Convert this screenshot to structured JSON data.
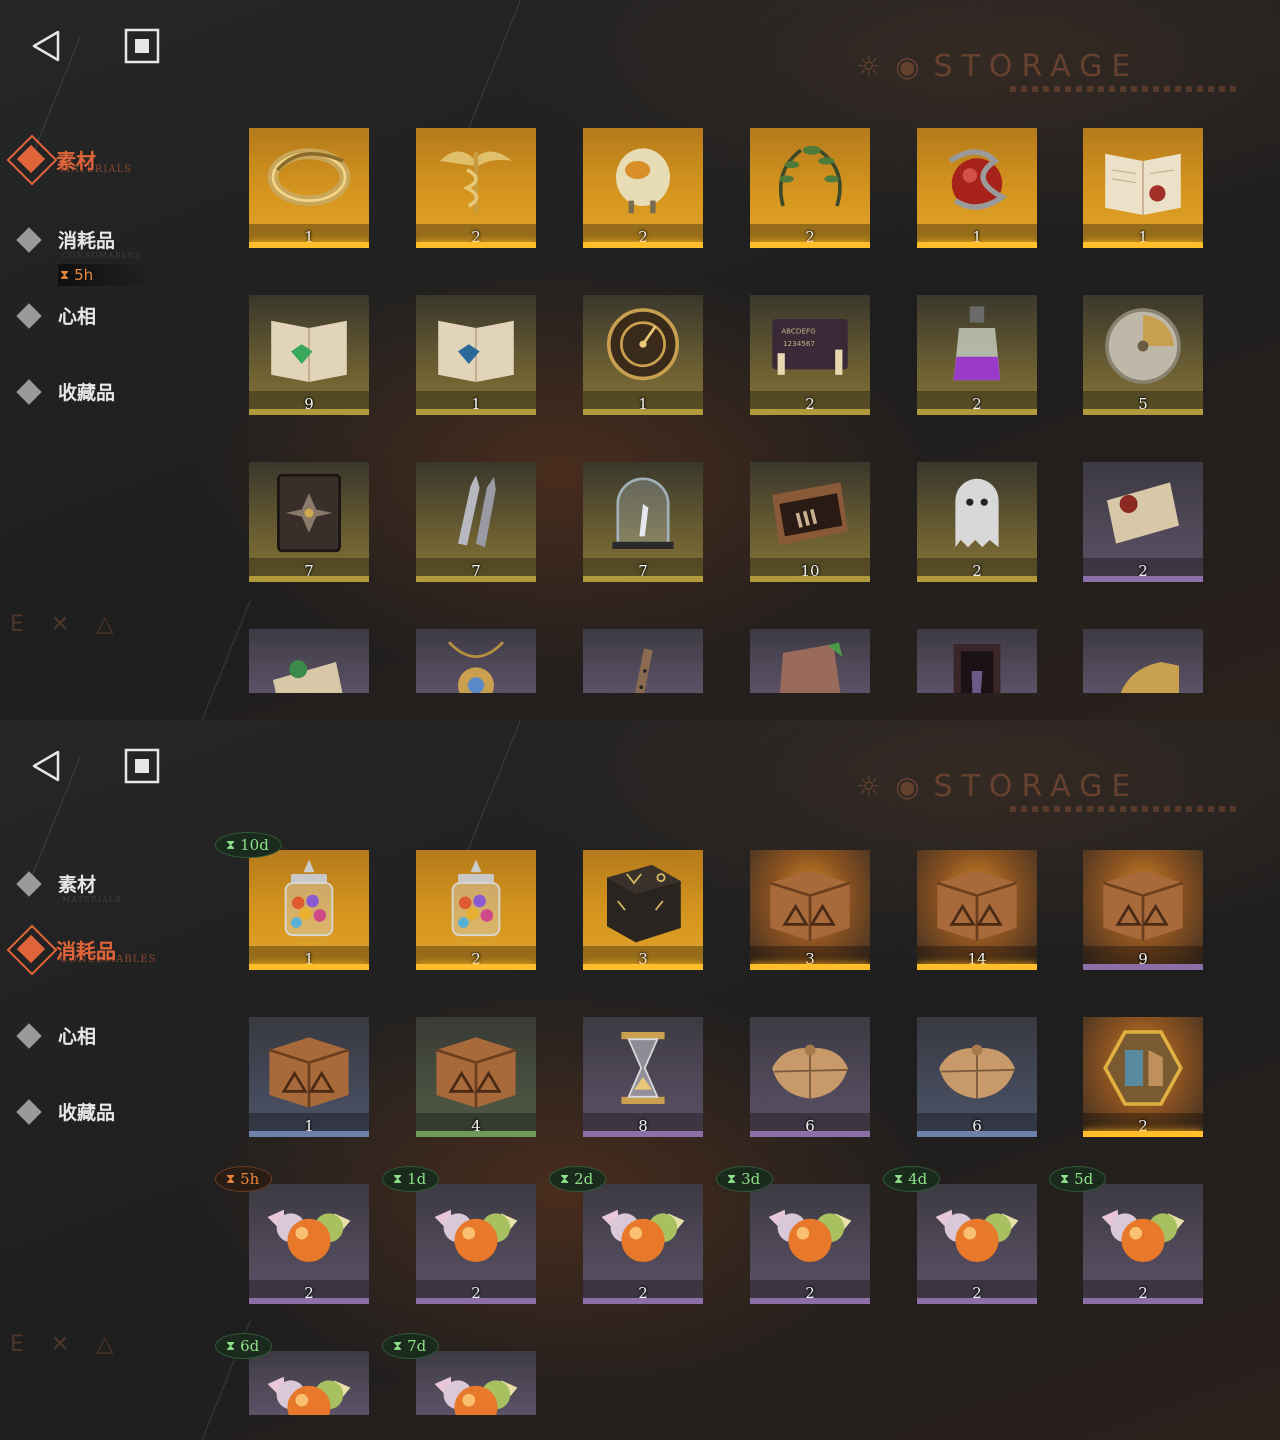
{
  "screens": [
    {
      "title": "STORAGE",
      "nav": [
        {
          "label": "素材",
          "sub": "MATERIALS",
          "active": true
        },
        {
          "label": "消耗品",
          "sub": "CONSUMABLES",
          "active": false,
          "timer": "5h"
        },
        {
          "label": "心相",
          "sub": "",
          "active": false
        },
        {
          "label": "收藏品",
          "sub": "",
          "active": false
        }
      ],
      "watermark": "E ✕ △",
      "items": [
        {
          "icon": "gold-bracelet-icon",
          "qty": "1",
          "rarity": "gold"
        },
        {
          "icon": "caduceus-icon",
          "qty": "2",
          "rarity": "gold"
        },
        {
          "icon": "wool-sheep-icon",
          "qty": "2",
          "rarity": "gold"
        },
        {
          "icon": "laurel-wreath-icon",
          "qty": "2",
          "rarity": "gold"
        },
        {
          "icon": "apple-snake-icon",
          "qty": "1",
          "rarity": "gold"
        },
        {
          "icon": "open-book-red-icon",
          "qty": "1",
          "rarity": "gold"
        },
        {
          "icon": "green-rune-book-icon",
          "qty": "9",
          "rarity": "ochre"
        },
        {
          "icon": "blue-rune-book-icon",
          "qty": "1",
          "rarity": "ochre"
        },
        {
          "icon": "astrolabe-icon",
          "qty": "1",
          "rarity": "ochre"
        },
        {
          "icon": "ouija-board-icon",
          "qty": "2",
          "rarity": "ochre"
        },
        {
          "icon": "potion-bottle-icon",
          "qty": "2",
          "rarity": "ochre"
        },
        {
          "icon": "brass-dial-icon",
          "qty": "5",
          "rarity": "ochre"
        },
        {
          "icon": "dark-tome-icon",
          "qty": "7",
          "rarity": "ochre"
        },
        {
          "icon": "bullets-icon",
          "qty": "7",
          "rarity": "ochre"
        },
        {
          "icon": "glass-dome-icon",
          "qty": "7",
          "rarity": "ochre"
        },
        {
          "icon": "hand-box-icon",
          "qty": "10",
          "rarity": "ochre"
        },
        {
          "icon": "ghost-sheet-icon",
          "qty": "2",
          "rarity": "ochre"
        },
        {
          "icon": "scroll-red-seal-icon",
          "qty": "2",
          "rarity": "purple"
        },
        {
          "icon": "scroll-green-seal-icon",
          "qty": "",
          "rarity": "purple"
        },
        {
          "icon": "pendant-icon",
          "qty": "",
          "rarity": "purple"
        },
        {
          "icon": "flute-icon",
          "qty": "",
          "rarity": "purple"
        },
        {
          "icon": "stone-tablet-icon",
          "qty": "",
          "rarity": "purple"
        },
        {
          "icon": "wood-frame-icon",
          "qty": "",
          "rarity": "purple"
        },
        {
          "icon": "brass-helmet-icon",
          "qty": "",
          "rarity": "purple"
        }
      ]
    },
    {
      "title": "STORAGE",
      "nav": [
        {
          "label": "素材",
          "sub": "MATERIALS",
          "active": false
        },
        {
          "label": "消耗品",
          "sub": "CONSUMABLES",
          "active": true
        },
        {
          "label": "心相",
          "sub": "",
          "active": false
        },
        {
          "label": "收藏品",
          "sub": "",
          "active": false
        }
      ],
      "watermark": "E ✕ △",
      "items": [
        {
          "icon": "candy-jar-icon",
          "qty": "1",
          "rarity": "gold",
          "timer": "10d"
        },
        {
          "icon": "candy-jar-icon",
          "qty": "2",
          "rarity": "gold"
        },
        {
          "icon": "rune-cube-icon",
          "qty": "3",
          "rarity": "gold"
        },
        {
          "icon": "wooden-crate-icon",
          "qty": "3",
          "rarity": "gold",
          "fx": true
        },
        {
          "icon": "wooden-crate-icon",
          "qty": "14",
          "rarity": "gold",
          "fx": true
        },
        {
          "icon": "wooden-crate-icon",
          "qty": "9",
          "rarity": "purple",
          "fx": true
        },
        {
          "icon": "wooden-crate-icon",
          "qty": "1",
          "rarity": "blue"
        },
        {
          "icon": "wooden-crate-icon",
          "qty": "4",
          "rarity": "green"
        },
        {
          "icon": "hourglass-icon",
          "qty": "8",
          "rarity": "purple"
        },
        {
          "icon": "paper-parcel-icon",
          "qty": "6",
          "rarity": "purple"
        },
        {
          "icon": "paper-parcel-icon",
          "qty": "6",
          "rarity": "blue"
        },
        {
          "icon": "hexagon-token-icon",
          "qty": "2",
          "rarity": "gold",
          "fx": true
        },
        {
          "icon": "candy-icon",
          "qty": "2",
          "rarity": "purple",
          "timer": "5h",
          "timer_color": "orange"
        },
        {
          "icon": "candy-icon",
          "qty": "2",
          "rarity": "purple",
          "timer": "1d"
        },
        {
          "icon": "candy-icon",
          "qty": "2",
          "rarity": "purple",
          "timer": "2d"
        },
        {
          "icon": "candy-icon",
          "qty": "2",
          "rarity": "purple",
          "timer": "3d"
        },
        {
          "icon": "candy-icon",
          "qty": "2",
          "rarity": "purple",
          "timer": "4d"
        },
        {
          "icon": "candy-icon",
          "qty": "2",
          "rarity": "purple",
          "timer": "5d"
        },
        {
          "icon": "candy-icon",
          "qty": "",
          "rarity": "purple",
          "timer": "6d"
        },
        {
          "icon": "candy-icon",
          "qty": "",
          "rarity": "purple",
          "timer": "7d"
        }
      ]
    }
  ],
  "hourglass_glyph": "⧗"
}
